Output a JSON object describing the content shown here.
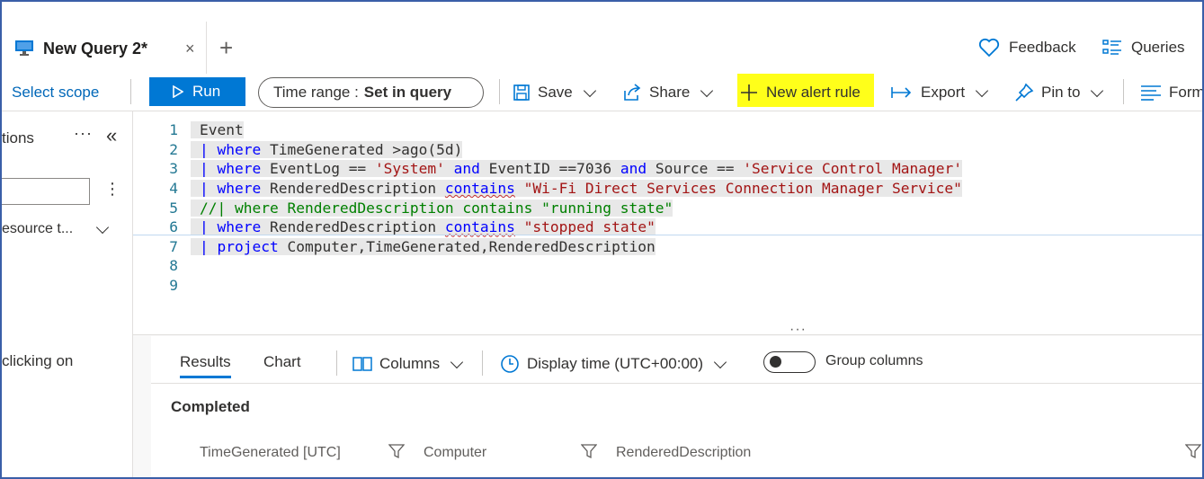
{
  "tab": {
    "title": "New Query 2*",
    "close": "×",
    "add": "+"
  },
  "header": {
    "feedback": "Feedback",
    "queries": "Queries"
  },
  "toolbar": {
    "select_scope": "Select scope",
    "run": "Run",
    "time_range_label": "Time range :",
    "time_range_value": "Set in query",
    "save": "Save",
    "share": "Share",
    "new_alert_rule": "New alert rule",
    "export": "Export",
    "pin_to": "Pin to",
    "format": "Form"
  },
  "left_panel": {
    "heading": "tions",
    "dots": "···",
    "collapse": "«",
    "more": "⋮",
    "resource_filter": "esource t...",
    "hint": "clicking on"
  },
  "editor": {
    "line_numbers": [
      "1",
      "2",
      "3",
      "4",
      "5",
      "6",
      "7",
      "8",
      "9"
    ],
    "tokens": {
      "l1_event": "Event",
      "pipe": "| ",
      "where": "where",
      "l2_rest": " TimeGenerated >ago(5d)",
      "l3_a": " EventLog == ",
      "l3_system": "'System'",
      "l3_and1": "and",
      "l3_b": " EventID ==7036 ",
      "l3_and2": "and",
      "l3_c": " Source == ",
      "l3_src": "'Service Control Manager'",
      "l4_a": " RenderedDescription ",
      "contains": "contains",
      "l4_str": "\"Wi-Fi Direct Services Connection Manager Service\"",
      "l5_comment": "//| where RenderedDescription contains \"running state\"",
      "l6_a": " RenderedDescription ",
      "l6_str": "\"stopped state\"",
      "project": "project",
      "l7_rest": " Computer,TimeGenerated,RenderedDescription"
    }
  },
  "splitter": "···",
  "results": {
    "tab_results": "Results",
    "tab_chart": "Chart",
    "columns": "Columns",
    "display_time": "Display time (UTC+00:00)",
    "group_columns": "Group columns",
    "status": "Completed",
    "headers": [
      "TimeGenerated [UTC]",
      "Computer",
      "RenderedDescription"
    ]
  },
  "colors": {
    "accent": "#0078d4",
    "highlight": "#ffff1a",
    "keyword": "#0000ff",
    "string": "#a31515",
    "comment": "#008000"
  }
}
